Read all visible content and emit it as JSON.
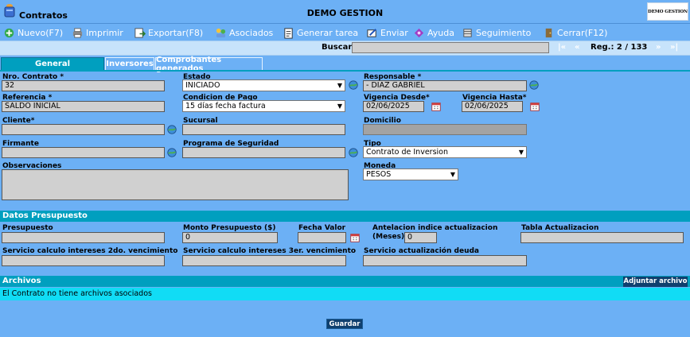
{
  "app": {
    "title": "Contratos",
    "company": "DEMO GESTION",
    "logo_text": "DEMO GESTION"
  },
  "toolbar": {
    "items": [
      {
        "label": "Nuevo(F7)",
        "icon": "new-icon"
      },
      {
        "label": "Imprimir",
        "icon": "printer-icon"
      },
      {
        "label": "Exportar(F8)",
        "icon": "export-icon"
      },
      {
        "label": "Asociados",
        "icon": "associates-icon"
      },
      {
        "label": "Generar tarea",
        "icon": "task-icon"
      },
      {
        "label": "Enviar",
        "icon": "send-icon"
      },
      {
        "label": "Ayuda",
        "icon": "help-icon"
      },
      {
        "label": "Seguimiento",
        "icon": "tracking-icon"
      },
      {
        "label": "Cerrar(F12)",
        "icon": "close-icon"
      }
    ]
  },
  "search": {
    "label": "Buscar",
    "value": ""
  },
  "nav": {
    "first": "|«",
    "prev": "«",
    "next": "»",
    "last": "»|",
    "record": "Reg.: 2 / 133"
  },
  "tabs": [
    {
      "label": "General",
      "active": true
    },
    {
      "label": "Inversores",
      "active": false
    },
    {
      "label": "Comprobantes generados",
      "active": false
    }
  ],
  "form": {
    "nro_contrato": {
      "label": "Nro. Contrato *",
      "value": "32"
    },
    "estado": {
      "label": "Estado",
      "value": "INICIADO"
    },
    "responsable": {
      "label": "Responsable *",
      "value": "- DIAZ GABRIEL"
    },
    "referencia": {
      "label": "Referencia *",
      "value": "SALDO INICIAL"
    },
    "condicion_pago": {
      "label": "Condicion de Pago",
      "value": "15 días fecha factura"
    },
    "vigencia_desde": {
      "label": "Vigencia Desde*",
      "value": "02/06/2025"
    },
    "vigencia_hasta": {
      "label": "Vigencia Hasta*",
      "value": "02/06/2025"
    },
    "cliente": {
      "label": "Cliente*",
      "value": ""
    },
    "sucursal": {
      "label": "Sucursal",
      "value": ""
    },
    "domicilio": {
      "label": "Domicilio",
      "value": ""
    },
    "firmante": {
      "label": "Firmante",
      "value": ""
    },
    "programa_seguridad": {
      "label": "Programa de Seguridad",
      "value": ""
    },
    "tipo": {
      "label": "Tipo",
      "value": "Contrato de Inversion"
    },
    "observaciones": {
      "label": "Observaciones",
      "value": ""
    },
    "moneda": {
      "label": "Moneda",
      "value": "PESOS"
    }
  },
  "presupuesto": {
    "title": "Datos Presupuesto",
    "presupuesto": {
      "label": "Presupuesto",
      "value": ""
    },
    "monto": {
      "label": "Monto Presupuesto ($)",
      "value": "0"
    },
    "fecha_valor": {
      "label": "Fecha Valor",
      "value": ""
    },
    "antelacion": {
      "label_line1": "Antelacion indice actualizacion",
      "label_line2": "(Meses)",
      "value": "0"
    },
    "tabla_actualizacion": {
      "label": "Tabla Actualizacion",
      "value": ""
    },
    "servicio_2do": {
      "label": "Servicio calculo intereses 2do. vencimiento",
      "value": ""
    },
    "servicio_3er": {
      "label": "Servicio calculo intereses 3er. vencimiento",
      "value": ""
    },
    "servicio_deuda": {
      "label": "Servicio actualización deuda",
      "value": ""
    }
  },
  "archivos": {
    "title": "Archivos",
    "attach_label": "Adjuntar archivo",
    "empty_message": "El Contrato no tiene archivos asociados"
  },
  "actions": {
    "save_label": "Guardar"
  }
}
